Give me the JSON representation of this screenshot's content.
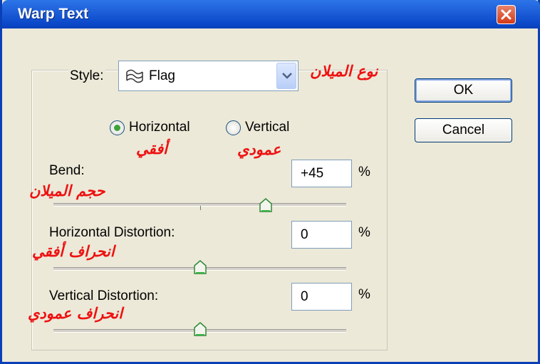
{
  "window": {
    "title": "Warp Text"
  },
  "style": {
    "label": "Style:",
    "value": "Flag",
    "icon": "flag-warp-icon"
  },
  "orientation": {
    "horizontal_label": "Horizontal",
    "vertical_label": "Vertical",
    "selected": "Horizontal"
  },
  "bend": {
    "label": "Bend:",
    "value": "+45",
    "unit": "%",
    "slider_value": 45
  },
  "horizontal_distortion": {
    "label": "Horizontal Distortion:",
    "value": "0",
    "unit": "%",
    "slider_value": 0
  },
  "vertical_distortion": {
    "label": "Vertical Distortion:",
    "value": "0",
    "unit": "%",
    "slider_value": 0
  },
  "buttons": {
    "ok": "OK",
    "cancel": "Cancel"
  },
  "annotations": {
    "style_ar": "نوع الميلان",
    "horizontal_ar": "أفقي",
    "vertical_ar": "عمودي",
    "bend_ar": "حجم الميلان",
    "hdist_ar": "انحراف أفقي",
    "vdist_ar": "انحراف عمودي"
  },
  "colors": {
    "annotation": "#EE1111",
    "titlebar": "#0A47C8",
    "dialog_bg": "#ECE9D8"
  }
}
